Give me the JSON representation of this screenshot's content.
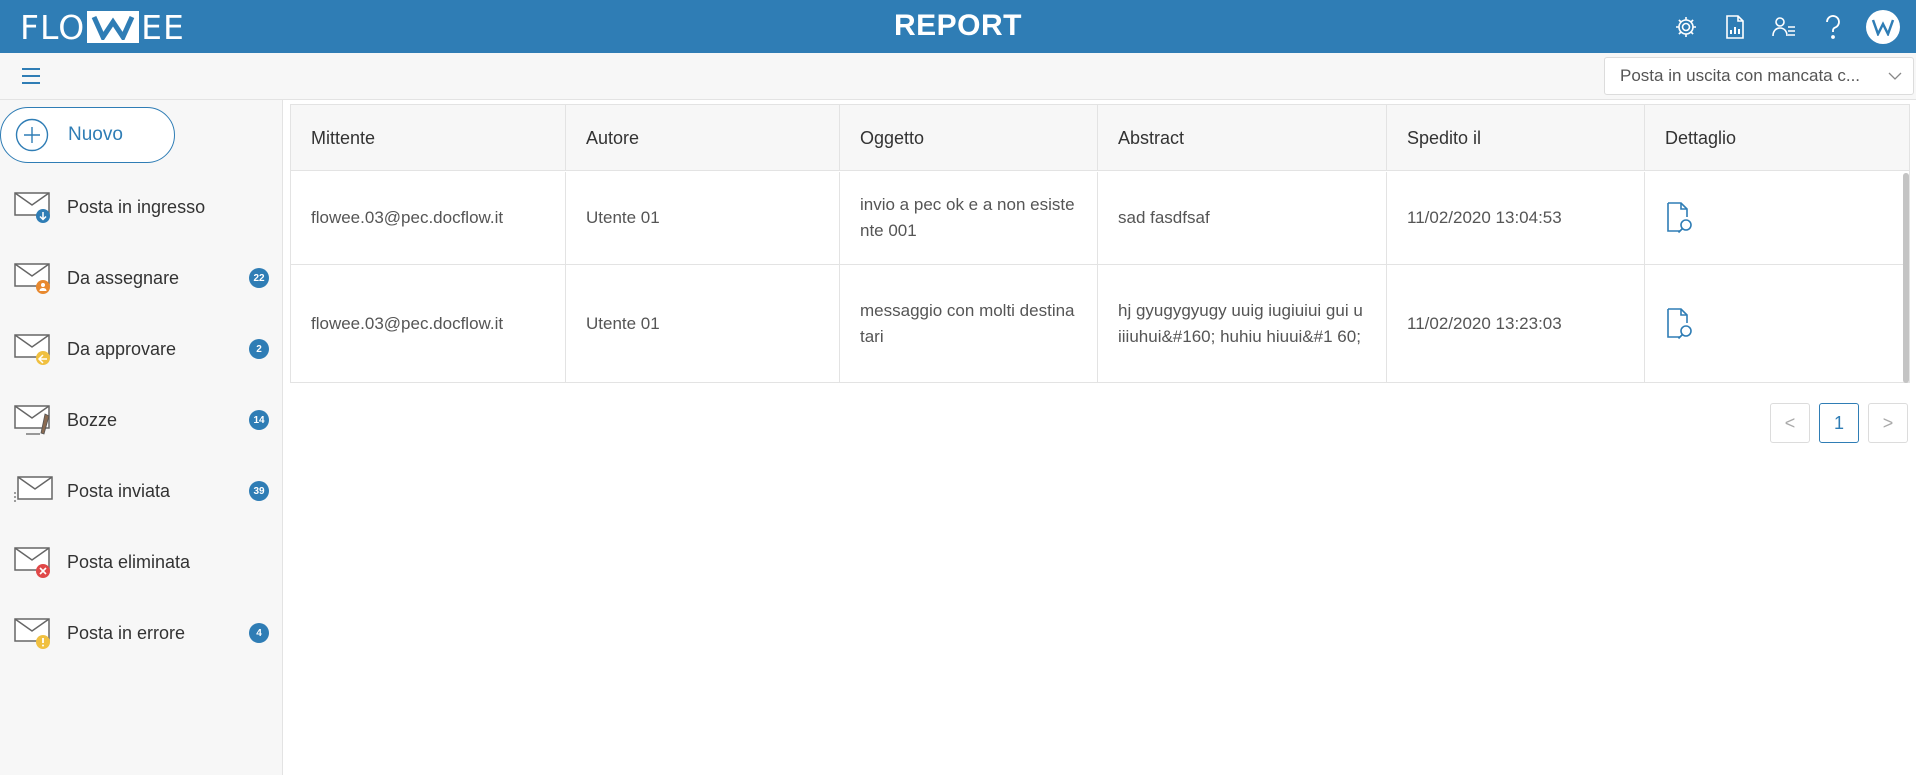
{
  "header": {
    "logo_left": "FLO",
    "logo_right": "EE",
    "title": "REPORT",
    "icons": [
      "gear-icon",
      "report-icon",
      "users-icon",
      "help-icon"
    ]
  },
  "toolbar": {
    "report_select_value": "Posta in uscita con mancata c..."
  },
  "sidebar": {
    "new_label": "Nuovo",
    "items": [
      {
        "label": "Posta in ingresso",
        "badge": ""
      },
      {
        "label": "Da assegnare",
        "badge": "22"
      },
      {
        "label": "Da approvare",
        "badge": "2"
      },
      {
        "label": "Bozze",
        "badge": "14"
      },
      {
        "label": "Posta inviata",
        "badge": "39"
      },
      {
        "label": "Posta eliminata",
        "badge": ""
      },
      {
        "label": "Posta in errore",
        "badge": "4"
      }
    ]
  },
  "table": {
    "columns": [
      "Mittente",
      "Autore",
      "Oggetto",
      "Abstract",
      "Spedito il",
      "Dettaglio"
    ],
    "rows": [
      {
        "mittente": "flowee.03@pec.docflow.it",
        "autore": "Utente 01",
        "oggetto": "invio a pec ok e a non esistente 001",
        "abstract": "sad fasdfsaf",
        "spedito": "11/02/2020 13:04:53"
      },
      {
        "mittente": "flowee.03@pec.docflow.it",
        "autore": "Utente 01",
        "oggetto": "messaggio con molti destinatari",
        "abstract": "hj gyugygyugy uuig iugiuiui gui uiiiuhui&#160; huhiu hiuui&#1 60;",
        "spedito": "11/02/2020 13:23:03"
      }
    ]
  },
  "pagination": {
    "prev": "<",
    "current": "1",
    "next": ">"
  },
  "colors": {
    "primary": "#2f7db5",
    "sidebar_bg": "#f7f7f7",
    "badge_bg": "#2f7db5"
  }
}
